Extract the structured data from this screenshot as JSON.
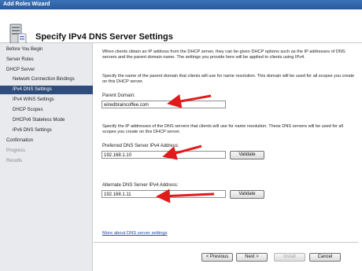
{
  "window": {
    "title": "Add Roles Wizard"
  },
  "header": {
    "title": "Specify IPv4 DNS Server Settings",
    "icon": "server-icon"
  },
  "sidebar": {
    "items": [
      {
        "label": "Before You Begin"
      },
      {
        "label": "Server Roles"
      },
      {
        "label": "DHCP Server"
      },
      {
        "label": "Network Connection Bindings"
      },
      {
        "label": "IPv4 DNS Settings"
      },
      {
        "label": "IPv4 WINS Settings"
      },
      {
        "label": "DHCP Scopes"
      },
      {
        "label": "DHCPv6 Stateless Mode"
      },
      {
        "label": "IPv6 DNS Settings"
      },
      {
        "label": "Confirmation"
      },
      {
        "label": "Progress"
      },
      {
        "label": "Results"
      }
    ]
  },
  "main": {
    "intro": "When clients obtain an IP address from the DHCP server, they can be given DHCP options such as the IP addresses of DNS servers and the parent domain name. The settings you provide here will be applied to clients using IPv4.",
    "domain_instructions": "Specify the name of the parent domain that clients will use for name resolution. This domain will be used for all scopes you create on this DHCP server.",
    "parent_domain": {
      "label": "Parent Domain:",
      "value": "wiredbraincoffee.com"
    },
    "dns_instructions": "Specify the IP addresses of the DNS servers that clients will use for name resolution. These DNS servers will be used for all scopes you create on this DHCP server.",
    "preferred_dns": {
      "label": "Preferred DNS Server IPv4 Address:",
      "value": "192.168.1.10",
      "validate_label": "Validate"
    },
    "alternate_dns": {
      "label": "Alternate DNS Server IPv4 Address:",
      "value": "192.168.1.11",
      "validate_label": "Validate"
    },
    "more_link": "More about DNS server settings"
  },
  "footer": {
    "previous": "< Previous",
    "next": "Next >",
    "install": "Install",
    "cancel": "Cancel"
  },
  "colors": {
    "titlebar": "#2f63a6",
    "sidebar_bg": "#e8eaed",
    "active_item": "#2f4d7c",
    "link": "#1a4fa0",
    "annotation_arrow": "#e11b1b"
  }
}
